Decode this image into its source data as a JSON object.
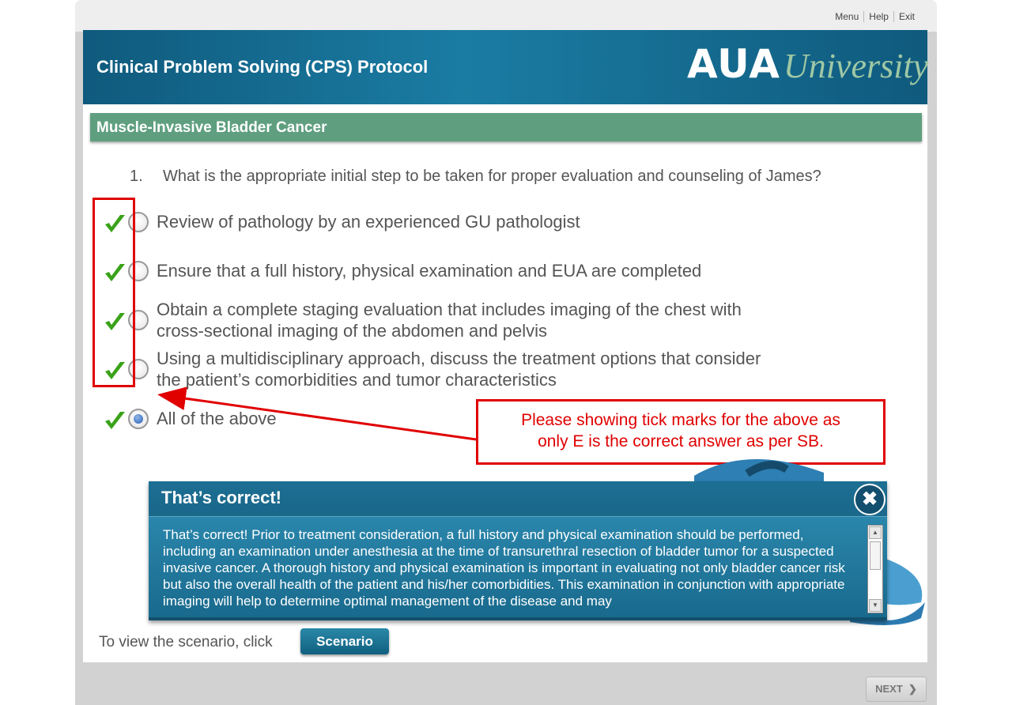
{
  "nav": {
    "menu": "Menu",
    "help": "Help",
    "exit": "Exit"
  },
  "header": {
    "title": "Clinical Problem Solving (CPS) Protocol",
    "logo_main": "AUA",
    "logo_sub": "University"
  },
  "section": {
    "title": "Muscle-Invasive Bladder Cancer"
  },
  "question": {
    "number": "1.",
    "text": "What is the appropriate initial step to be taken for proper evaluation and counseling of James?",
    "options": [
      {
        "line1": "Review of pathology by an experienced GU pathologist",
        "line2": "",
        "selected": false,
        "ticked": true
      },
      {
        "line1": "Ensure that a full history, physical examination and EUA are completed",
        "line2": "",
        "selected": false,
        "ticked": true
      },
      {
        "line1": "Obtain a complete staging evaluation that includes imaging of the chest with",
        "line2": "cross-sectional imaging of the abdomen and pelvis",
        "selected": false,
        "ticked": true
      },
      {
        "line1": "Using a multidisciplinary approach, discuss the treatment options that consider",
        "line2": "the patient’s comorbidities and tumor characteristics",
        "selected": false,
        "ticked": true
      },
      {
        "line1": "All of the above",
        "line2": "",
        "selected": true,
        "ticked": true
      }
    ]
  },
  "annotation": {
    "line1": "Please showing tick marks for the above as",
    "line2": "only E is the correct answer as per SB."
  },
  "feedback": {
    "title": "That’s correct!",
    "close_icon": "close-icon",
    "text": "That’s correct! Prior to treatment consideration, a full history and physical examination should be performed, including an examination under anesthesia at the time of transurethral resection of bladder tumor for a suspected invasive cancer. A thorough history and physical examination is important in evaluating not only bladder cancer risk but also the overall health of the patient and his/her comorbidities. This examination in conjunction with appropriate imaging will help to determine optimal management of the disease and may"
  },
  "scenario": {
    "label": "To view the scenario, click",
    "button": "Scenario"
  },
  "footer": {
    "next": "NEXT"
  },
  "colors": {
    "header": "#0f5a7d",
    "section": "#5f9f7f",
    "annotation": "#e00000",
    "tick": "#3aa21a"
  }
}
